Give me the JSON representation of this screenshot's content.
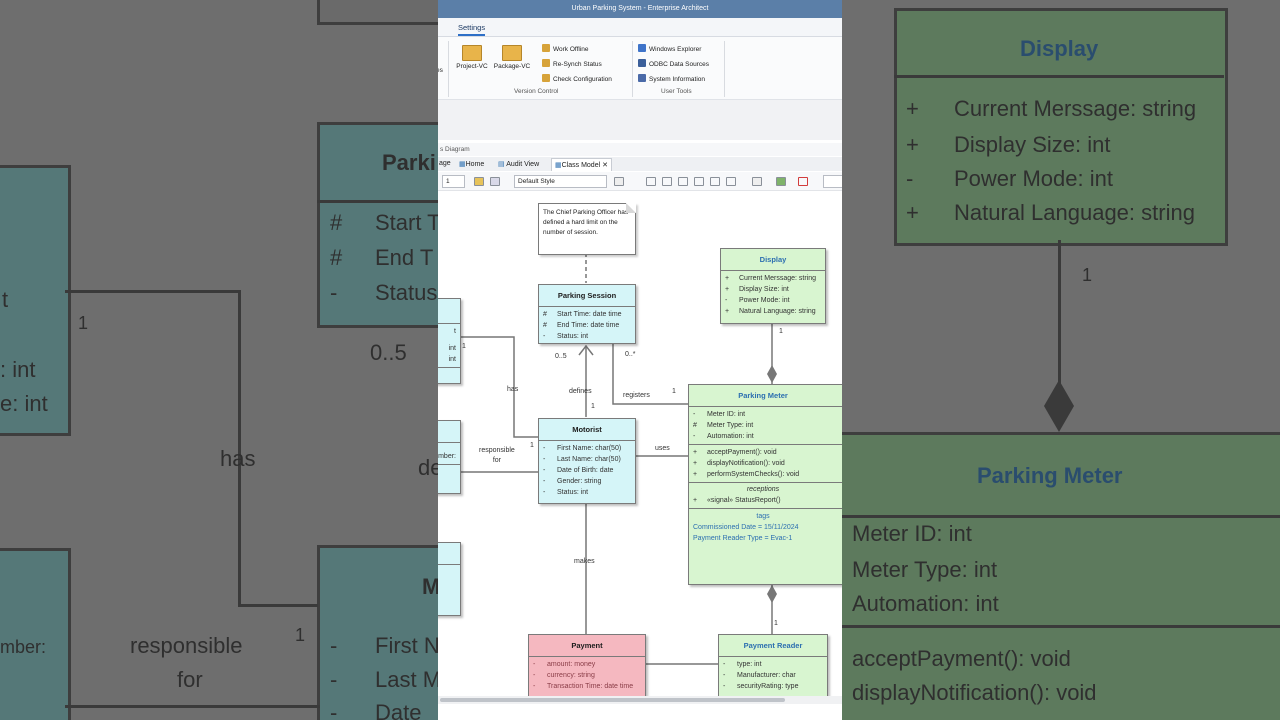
{
  "window": {
    "title": "Urban Parking System - Enterprise Architect"
  },
  "ribbon": {
    "active_tab": "Settings",
    "partial_left": "es",
    "big_buttons": [
      "Project-VC",
      "Package-VC"
    ],
    "vc_items": [
      "Work Offline",
      "Re-Synch Status",
      "Check Configuration"
    ],
    "vc_group": "Version Control",
    "ut_items": [
      "Windows Explorer",
      "ODBC Data Sources",
      "System Information"
    ],
    "ut_group": "User Tools"
  },
  "pane": {
    "title": "s Diagram",
    "tabs": [
      "age",
      "Home",
      "Audit View",
      "Class Model"
    ],
    "close_glyph": "✕"
  },
  "toolbar": {
    "zoom_value": "1",
    "style_select": "Default Style"
  },
  "note": {
    "text": "The Chief Parking Officer has defined a hard limit on the number of session."
  },
  "classes": {
    "parking_session": {
      "name": "Parking Session",
      "attributes": [
        {
          "vis": "#",
          "text": "Start Time: date time"
        },
        {
          "vis": "#",
          "text": "End Time: date time"
        },
        {
          "vis": "-",
          "text": "Status: int"
        }
      ]
    },
    "motorist": {
      "name": "Motorist",
      "attributes": [
        {
          "vis": "-",
          "text": "First Name: char(50)"
        },
        {
          "vis": "-",
          "text": "Last Name: char(50)"
        },
        {
          "vis": "-",
          "text": "Date of Birth: date"
        },
        {
          "vis": "-",
          "text": "Gender: string"
        },
        {
          "vis": "-",
          "text": "Status: int"
        }
      ]
    },
    "display": {
      "name": "Display",
      "attributes": [
        {
          "vis": "+",
          "text": "Current Merssage: string"
        },
        {
          "vis": "+",
          "text": "Display Size: int"
        },
        {
          "vis": "-",
          "text": "Power Mode: int"
        },
        {
          "vis": "+",
          "text": "Natural Language: string"
        }
      ]
    },
    "parking_meter": {
      "name": "Parking Meter",
      "attributes": [
        {
          "vis": "-",
          "text": "Meter ID: int"
        },
        {
          "vis": "#",
          "text": "Meter Type: int"
        },
        {
          "vis": "-",
          "text": "Automation: int"
        }
      ],
      "operations": [
        {
          "vis": "+",
          "text": "acceptPayment(): void"
        },
        {
          "vis": "+",
          "text": "displayNotification(): void"
        },
        {
          "vis": "+",
          "text": "performSystemChecks(): void"
        }
      ],
      "receptions_label": "receptions",
      "receptions": [
        {
          "vis": "+",
          "text": "«signal» StatusReport()"
        }
      ],
      "tags_label": "tags",
      "tags": [
        "Commissioned Date = 15/11/2024",
        "Payment Reader Type = Evac-1"
      ]
    },
    "payment": {
      "name": "Payment",
      "attributes": [
        {
          "vis": "-",
          "text": "amount: money"
        },
        {
          "vis": "-",
          "text": "currency: string"
        },
        {
          "vis": "-",
          "text": "Transaction Time: date time"
        }
      ]
    },
    "payment_reader": {
      "name": "Payment Reader",
      "attributes": [
        {
          "vis": "-",
          "text": "type: int"
        },
        {
          "vis": "-",
          "text": "Manufacturer: char"
        },
        {
          "vis": "-",
          "text": "securityRating: type"
        }
      ]
    },
    "left_partial_1": {
      "attributes": [
        "int",
        "int"
      ],
      "extra": "t"
    },
    "left_partial_2": {
      "attributes": [
        "mber:"
      ]
    }
  },
  "labels": {
    "has": "has",
    "defines": "defines",
    "registers": "registers",
    "responsible_for": "responsible\nfor",
    "uses": "uses",
    "makes": "makes",
    "m_0_5": "0..5",
    "m_0_star": "0..*",
    "m_1": "1"
  },
  "background": {
    "left_texts": [
      "Parki",
      "#",
      "Start T",
      "#",
      "End T",
      "-",
      "Status",
      "t",
      "0..5",
      "1",
      ": int",
      "e: int",
      "has",
      "responsible",
      "for",
      "de",
      "mber:",
      "1",
      "-",
      "First N",
      "-",
      "Last M",
      "-",
      "Date",
      "M"
    ],
    "right_texts": [
      "Display",
      "+",
      "Current Merssage: string",
      "+",
      "Display Size: int",
      "-",
      "Power Mode: int",
      "+",
      "Natural Language: string",
      "1",
      "Parking Meter",
      "Meter ID: int",
      "Meter Type: int",
      "Automation: int",
      "acceptPayment(): void",
      "displayNotification(): void"
    ]
  }
}
